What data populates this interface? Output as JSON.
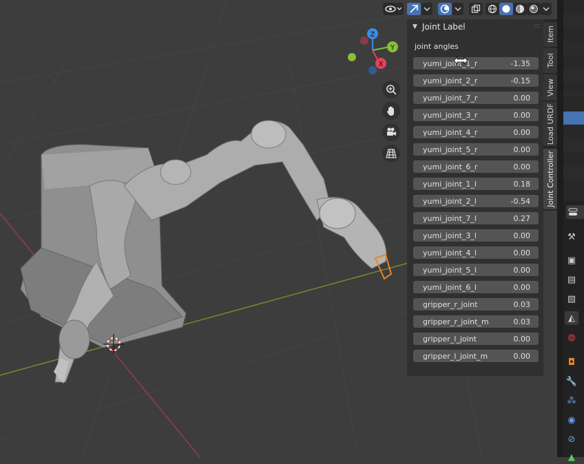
{
  "npanel": {
    "panel_title": "Joint Label",
    "section_label": "joint angles",
    "joints": [
      {
        "name": "yumi_joint_1_r",
        "value": "-1.35"
      },
      {
        "name": "yumi_joint_2_r",
        "value": "-0.15"
      },
      {
        "name": "yumi_joint_7_r",
        "value": "0.00"
      },
      {
        "name": "yumi_joint_3_r",
        "value": "0.00"
      },
      {
        "name": "yumi_joint_4_r",
        "value": "0.00"
      },
      {
        "name": "yumi_joint_5_r",
        "value": "0.00"
      },
      {
        "name": "yumi_joint_6_r",
        "value": "0.00"
      },
      {
        "name": "yumi_joint_1_l",
        "value": "0.18"
      },
      {
        "name": "yumi_joint_2_l",
        "value": "-0.54"
      },
      {
        "name": "yumi_joint_7_l",
        "value": "0.27"
      },
      {
        "name": "yumi_joint_3_l",
        "value": "0.00"
      },
      {
        "name": "yumi_joint_4_l",
        "value": "0.00"
      },
      {
        "name": "yumi_joint_5_l",
        "value": "0.00"
      },
      {
        "name": "yumi_joint_6_l",
        "value": "0.00"
      },
      {
        "name": "gripper_r_joint",
        "value": "0.03"
      },
      {
        "name": "gripper_r_joint_m",
        "value": "0.03"
      },
      {
        "name": "gripper_l_joint",
        "value": "0.00"
      },
      {
        "name": "gripper_l_joint_m",
        "value": "0.00"
      }
    ]
  },
  "sidebar_tabs": [
    "Item",
    "Tool",
    "View",
    "Load URDF",
    "Joint Controller"
  ],
  "active_tab": "Joint Controller",
  "gizmo": {
    "x_label": "X",
    "y_label": "Y",
    "z_label": "Z"
  },
  "colors": {
    "axis_x": "#e4415b",
    "axis_y": "#8bbd36",
    "axis_z": "#3c8ce6",
    "accent": "#4772b3",
    "grid_x_line": "#9a3a4a",
    "grid_y_line": "#6e8f2e",
    "selection_outline": "#e8842c"
  },
  "icons": {
    "header": [
      "view-eye-icon",
      "gizmo-toggle-icon",
      "overlay-toggle-icon",
      "xray-icon",
      "wireframe-shading-icon",
      "solid-shading-icon",
      "material-shading-icon",
      "rendered-shading-icon"
    ],
    "navigation": [
      "zoom-icon",
      "pan-hand-icon",
      "camera-icon",
      "grid-ortho-icon"
    ],
    "properties": [
      "tool-icon",
      "render-icon",
      "output-icon",
      "view-layer-icon",
      "scene-icon",
      "world-icon",
      "object-icon",
      "modifier-icon",
      "particles-icon",
      "physics-icon",
      "constraints-icon",
      "data-icon"
    ]
  }
}
